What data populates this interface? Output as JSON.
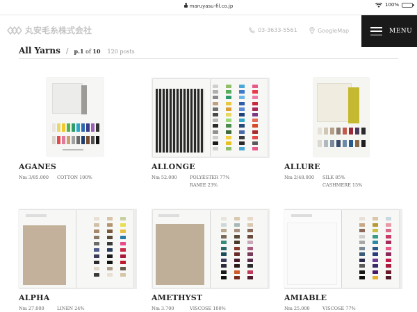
{
  "status": {
    "url": "maruyasu-fil.co.jp",
    "battery": "100%"
  },
  "header": {
    "logo_text": "丸安毛糸株式会社",
    "phone": "03-3633-5561",
    "map": "GoogleMap",
    "menu_label": "MENU"
  },
  "title": {
    "heading": "All Yarns",
    "separator": "/",
    "page_prefix": "p.",
    "page_current": "1",
    "page_of": "of",
    "page_total": "10",
    "posts": "120 posts"
  },
  "cards": [
    {
      "name": "AGANES",
      "nm": "Nm 3/85.000",
      "comp1": "COTTON 100%",
      "comp2": ""
    },
    {
      "name": "ALLONGE",
      "nm": "Nm 52.000",
      "comp1": "POLYESTER 77%",
      "comp2": "RAMIE 23%"
    },
    {
      "name": "ALLURE",
      "nm": "Nm 2/48.000",
      "comp1": "SILK 85%",
      "comp2": "CASHMERE 15%"
    },
    {
      "name": "ALPHA",
      "nm": "Nm 27.000",
      "comp1": "LINEN 24%",
      "comp2": ""
    },
    {
      "name": "AMETHYST",
      "nm": "Nm 3.700",
      "comp1": "VISCOSE 100%",
      "comp2": ""
    },
    {
      "name": "AMIABLE",
      "nm": "Nm 25.000",
      "comp1": "VISCOSE 77%",
      "comp2": ""
    }
  ]
}
